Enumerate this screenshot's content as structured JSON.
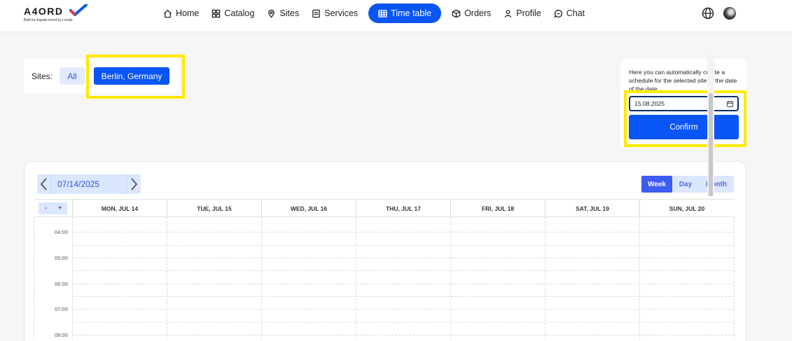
{
  "brand": {
    "name": "A4ORD",
    "tagline": "Built for Expats loved by Locals",
    "check_color": "#0a55f5",
    "check_accent": "#e53935"
  },
  "nav": {
    "items": [
      {
        "label": "Home",
        "icon": "home-icon"
      },
      {
        "label": "Catalog",
        "icon": "catalog-icon"
      },
      {
        "label": "Sites",
        "icon": "location-pin-icon"
      },
      {
        "label": "Services",
        "icon": "services-icon"
      },
      {
        "label": "Time table",
        "icon": "table-icon",
        "active": true
      },
      {
        "label": "Orders",
        "icon": "box-icon"
      },
      {
        "label": "Profile",
        "icon": "user-icon"
      },
      {
        "label": "Chat",
        "icon": "chat-icon"
      }
    ],
    "accent": "#0a55f5"
  },
  "sites": {
    "label": "Sites:",
    "all": "All",
    "selected": "Berlin, Germany"
  },
  "schedule": {
    "description": "Here you can automatically create a schedule for the selected site to the date of the date",
    "date_value": "15.08.2025",
    "confirm_label": "Confirm"
  },
  "highlight_color": "#ffea00",
  "calendar": {
    "current_date": "07/14/2025",
    "views": {
      "week": "Week",
      "day": "Day",
      "month": "Month",
      "active": "Week"
    },
    "zoom_out": "-",
    "zoom_in": "+",
    "days": [
      "MON, JUL 14",
      "TUE, JUL 15",
      "WED, JUL 16",
      "THU, JUL 17",
      "FRI, JUL 18",
      "SAT, JUL 19",
      "SUN, JUL 20"
    ],
    "times": [
      "04:00",
      "05:00",
      "06:00",
      "07:00",
      "08:00"
    ]
  }
}
